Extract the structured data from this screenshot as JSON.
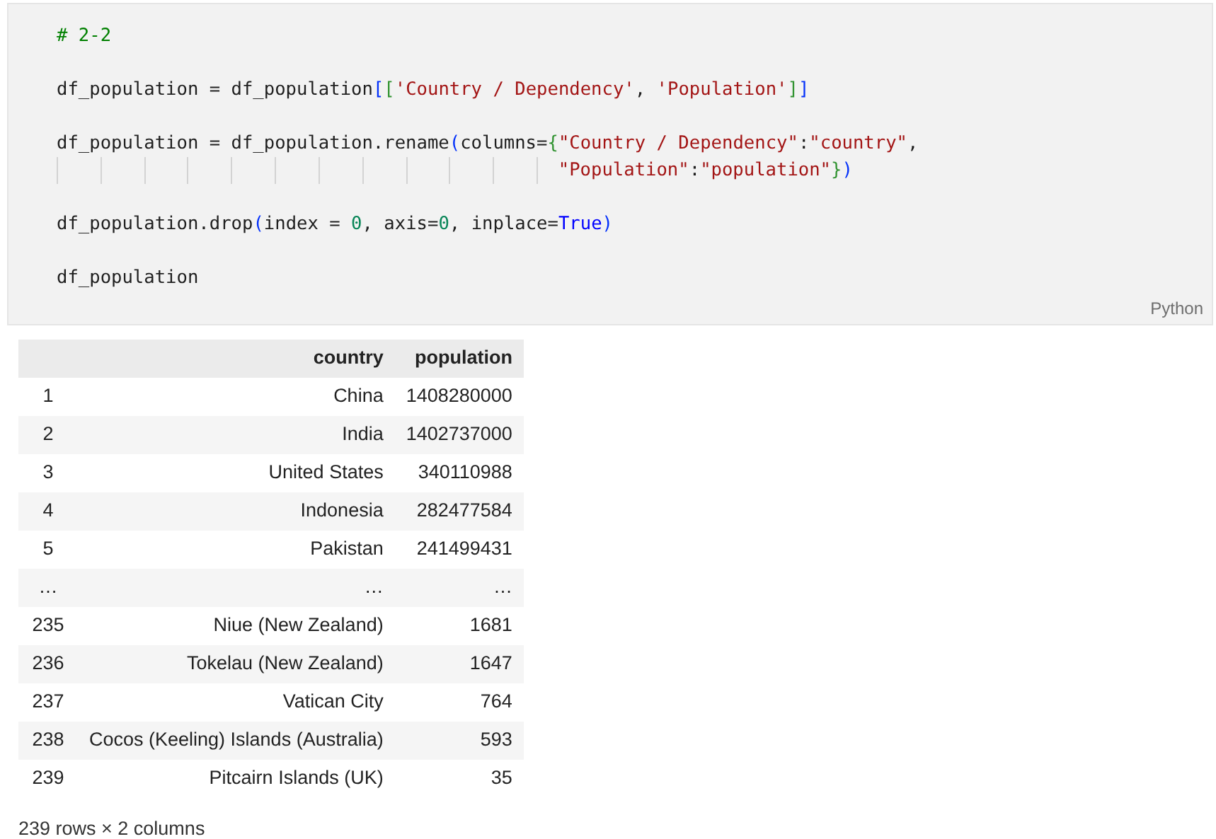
{
  "code_cell": {
    "lines": [
      {
        "kind": "statement",
        "tokens": [
          {
            "text": "# 2-2",
            "kind": "comment"
          }
        ]
      },
      {
        "kind": "statement",
        "tokens": [
          {
            "text": "df_population = df_population",
            "kind": "plain"
          },
          {
            "text": "[",
            "kind": "bracket1"
          },
          {
            "text": "[",
            "kind": "bracket2"
          },
          {
            "text": "'Country / Dependency'",
            "kind": "string"
          },
          {
            "text": ", ",
            "kind": "plain"
          },
          {
            "text": "'Population'",
            "kind": "string"
          },
          {
            "text": "]",
            "kind": "bracket2"
          },
          {
            "text": "]",
            "kind": "bracket1"
          }
        ]
      },
      {
        "kind": "statement",
        "tokens": [
          {
            "text": "df_population = df_population.rename",
            "kind": "plain"
          },
          {
            "text": "(",
            "kind": "bracket1"
          },
          {
            "text": "columns=",
            "kind": "plain"
          },
          {
            "text": "{",
            "kind": "bracket2"
          },
          {
            "text": "\"Country / Dependency\"",
            "kind": "string"
          },
          {
            "text": ":",
            "kind": "plain"
          },
          {
            "text": "\"country\"",
            "kind": "string"
          },
          {
            "text": ",",
            "kind": "plain"
          }
        ]
      },
      {
        "kind": "continuation",
        "tokens": [
          {
            "text": "\"Population\"",
            "kind": "string"
          },
          {
            "text": ":",
            "kind": "plain"
          },
          {
            "text": "\"population\"",
            "kind": "string"
          },
          {
            "text": "}",
            "kind": "bracket2"
          },
          {
            "text": ")",
            "kind": "bracket1"
          }
        ]
      },
      {
        "kind": "statement",
        "tokens": [
          {
            "text": "df_population.drop",
            "kind": "plain"
          },
          {
            "text": "(",
            "kind": "bracket1"
          },
          {
            "text": "index = ",
            "kind": "plain"
          },
          {
            "text": "0",
            "kind": "number"
          },
          {
            "text": ", axis=",
            "kind": "plain"
          },
          {
            "text": "0",
            "kind": "number"
          },
          {
            "text": ", inplace=",
            "kind": "plain"
          },
          {
            "text": "True",
            "kind": "keyword"
          },
          {
            "text": ")",
            "kind": "bracket1"
          }
        ]
      },
      {
        "kind": "statement",
        "tokens": [
          {
            "text": "df_population",
            "kind": "plain"
          }
        ]
      }
    ],
    "language": "Python"
  },
  "table": {
    "columns": [
      "country",
      "population"
    ],
    "rows": [
      {
        "index": "1",
        "cells": [
          "China",
          "1408280000"
        ]
      },
      {
        "index": "2",
        "cells": [
          "India",
          "1402737000"
        ]
      },
      {
        "index": "3",
        "cells": [
          "United States",
          "340110988"
        ]
      },
      {
        "index": "4",
        "cells": [
          "Indonesia",
          "282477584"
        ]
      },
      {
        "index": "5",
        "cells": [
          "Pakistan",
          "241499431"
        ]
      },
      {
        "index": "…",
        "cells": [
          "…",
          "…"
        ]
      },
      {
        "index": "235",
        "cells": [
          "Niue (New Zealand)",
          "1681"
        ]
      },
      {
        "index": "236",
        "cells": [
          "Tokelau (New Zealand)",
          "1647"
        ]
      },
      {
        "index": "237",
        "cells": [
          "Vatican City",
          "764"
        ]
      },
      {
        "index": "238",
        "cells": [
          "Cocos (Keeling) Islands (Australia)",
          "593"
        ]
      },
      {
        "index": "239",
        "cells": [
          "Pitcairn Islands (UK)",
          "35"
        ]
      }
    ],
    "shape": "239 rows × 2 columns"
  }
}
